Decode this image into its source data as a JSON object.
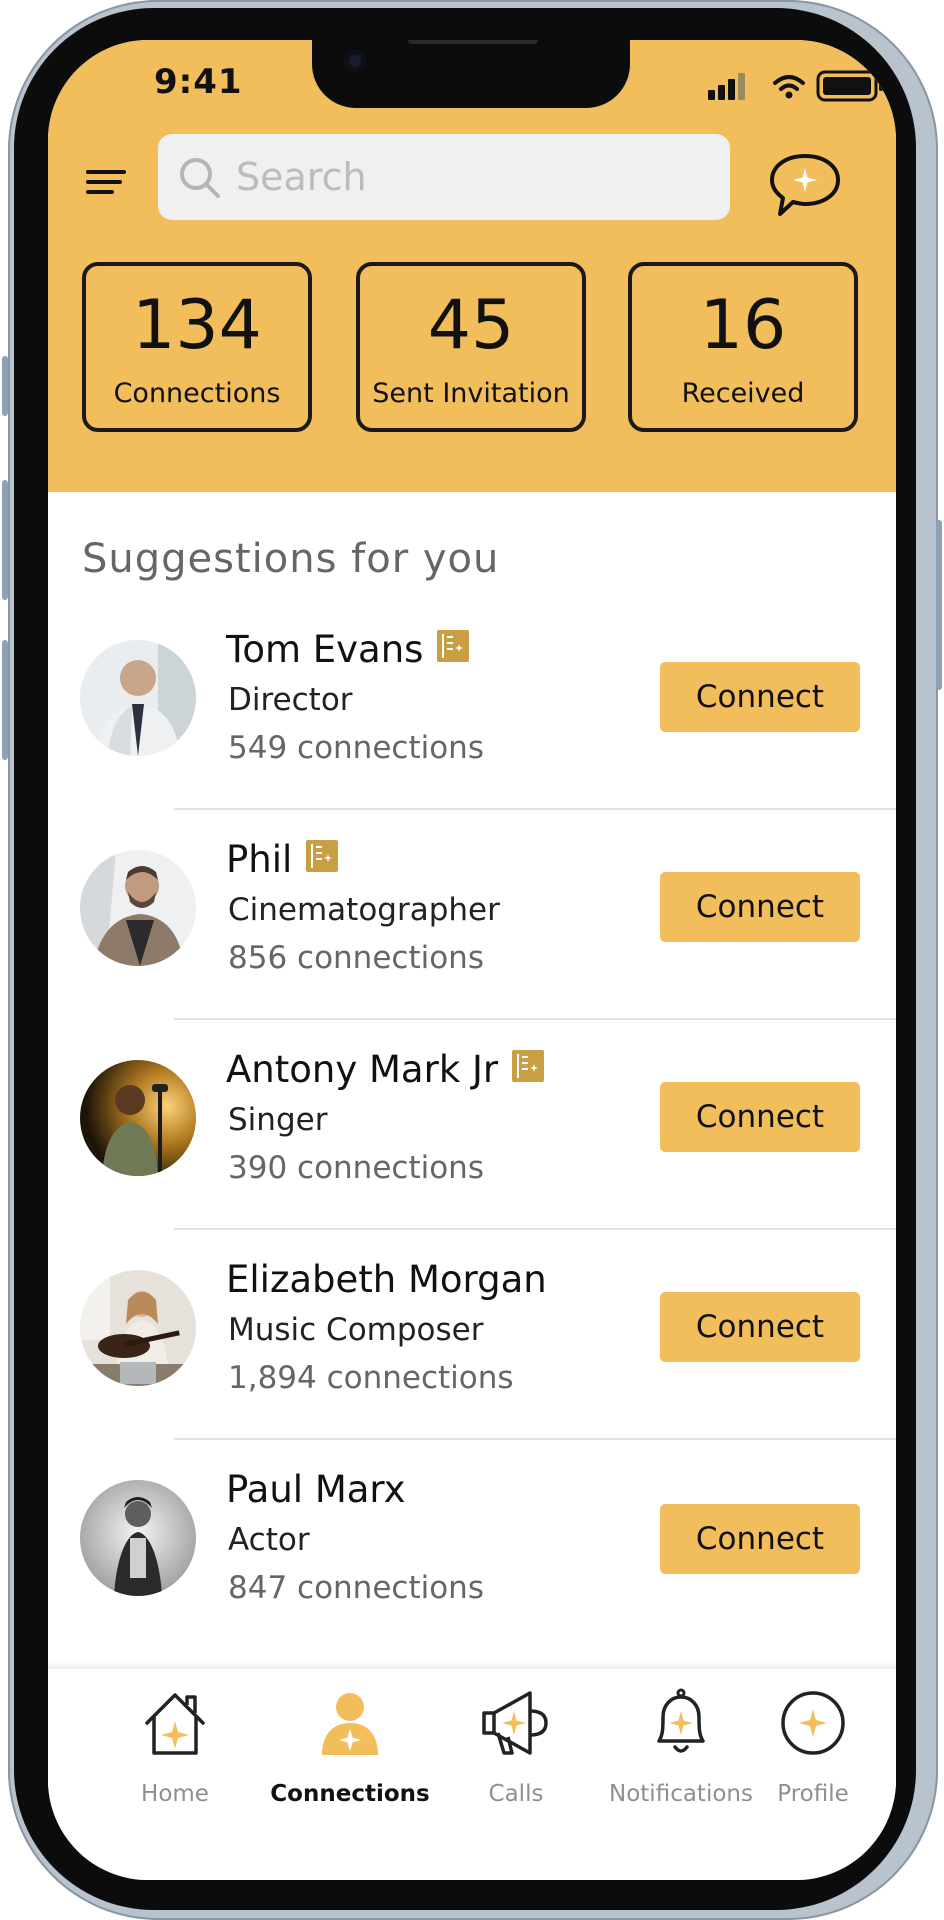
{
  "status_bar": {
    "time": "9:41"
  },
  "header": {
    "search": {
      "placeholder": "Search",
      "value": ""
    },
    "stats": [
      {
        "value": "134",
        "label": "Connections"
      },
      {
        "value": "45",
        "label": "Sent Invitation"
      },
      {
        "value": "16",
        "label": "Received"
      }
    ]
  },
  "suggestions": {
    "title": "Suggestions for you",
    "connect_label": "Connect",
    "people": [
      {
        "name": "Tom Evans",
        "role": "Director",
        "connections": "549 connections",
        "verified_badge": true
      },
      {
        "name": "Phil",
        "role": "Cinematographer",
        "connections": "856 connections",
        "verified_badge": true
      },
      {
        "name": "Antony Mark Jr",
        "role": "Singer",
        "connections": "390 connections",
        "verified_badge": true
      },
      {
        "name": "Elizabeth Morgan",
        "role": "Music Composer",
        "connections": "1,894 connections",
        "verified_badge": false
      },
      {
        "name": "Paul Marx",
        "role": "Actor",
        "connections": "847 connections",
        "verified_badge": false
      }
    ]
  },
  "tabbar": {
    "active": "Connections",
    "items": [
      {
        "label": "Home",
        "icon": "home-icon"
      },
      {
        "label": "Connections",
        "icon": "person-icon"
      },
      {
        "label": "Calls",
        "icon": "megaphone-icon"
      },
      {
        "label": "Notifications",
        "icon": "bell-icon"
      },
      {
        "label": "Profile",
        "icon": "profile-star-icon"
      }
    ]
  },
  "colors": {
    "accent": "#f2be5c",
    "badge": "#c99f44",
    "text": "#111111",
    "muted": "#666666"
  }
}
